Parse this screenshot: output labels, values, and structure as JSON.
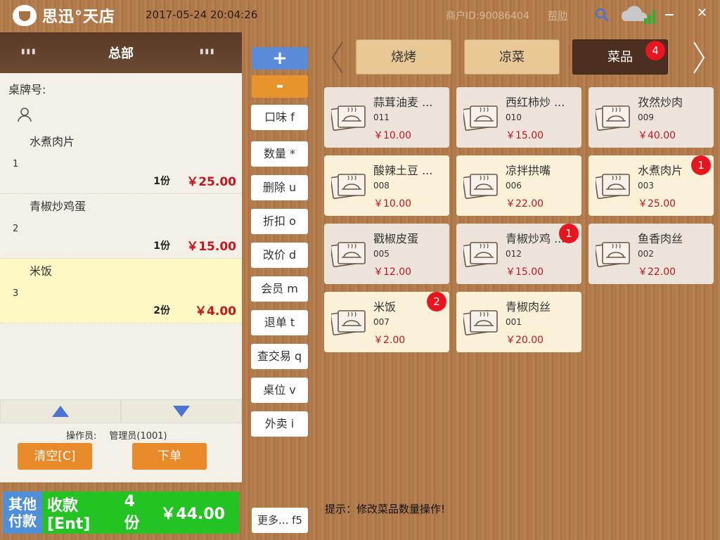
{
  "app": {
    "logo_text": "思迅°天店",
    "datetime": "2017-05-24 20:04:26",
    "merchant": "商户ID:90086404",
    "help": "帮助"
  },
  "left": {
    "header": "总部",
    "table_label": "桌牌号:",
    "items": [
      {
        "name": "水煮肉片",
        "index": "1",
        "qty": "1份",
        "price": "￥25.00"
      },
      {
        "name": "青椒炒鸡蛋",
        "index": "2",
        "qty": "1份",
        "price": "￥15.00"
      },
      {
        "name": "米饭",
        "index": "3",
        "qty": "2份",
        "price": "￥4.00"
      }
    ],
    "operator_label": "操作员:",
    "operator_name": "管理员(1001)",
    "clear": "清空[C]",
    "submit": "下单"
  },
  "pay": {
    "other": "其他付款",
    "pay": "收款[Ent]",
    "count": "4份",
    "total": "￥44.00"
  },
  "mid": {
    "plus": "+",
    "minus": "-",
    "buttons": [
      "口味 f",
      "数量 *",
      "删除 u",
      "折扣 o",
      "改价 d",
      "会员 m",
      "退单 t",
      "查交易 q",
      "桌位 v",
      "外卖 i"
    ],
    "more": "更多... f5"
  },
  "categories": [
    {
      "label": "烧烤",
      "badge": ""
    },
    {
      "label": "凉菜",
      "badge": ""
    },
    {
      "label": "菜品",
      "badge": "4"
    }
  ],
  "dishes": [
    {
      "name": "蒜茸油麦 ...",
      "code": "011",
      "price": "￥10.00",
      "badge": ""
    },
    {
      "name": "西红柿炒 ...",
      "code": "010",
      "price": "￥15.00",
      "badge": ""
    },
    {
      "name": "孜然炒肉",
      "code": "009",
      "price": "￥40.00",
      "badge": ""
    },
    {
      "name": "酸辣土豆 ...",
      "code": "008",
      "price": "￥10.00",
      "badge": ""
    },
    {
      "name": "凉拌拱嘴",
      "code": "006",
      "price": "￥22.00",
      "badge": ""
    },
    {
      "name": "水煮肉片",
      "code": "003",
      "price": "￥25.00",
      "badge": "1"
    },
    {
      "name": "戳椒皮蛋",
      "code": "005",
      "price": "￥12.00",
      "badge": ""
    },
    {
      "name": "青椒炒鸡 ...",
      "code": "012",
      "price": "￥15.00",
      "badge": "1"
    },
    {
      "name": "鱼香肉丝",
      "code": "002",
      "price": "￥22.00",
      "badge": ""
    },
    {
      "name": "米饭",
      "code": "007",
      "price": "￥2.00",
      "badge": "2"
    },
    {
      "name": "青椒肉丝",
      "code": "001",
      "price": "￥20.00",
      "badge": ""
    }
  ],
  "hint": "提示：修改菜品数量操作!"
}
